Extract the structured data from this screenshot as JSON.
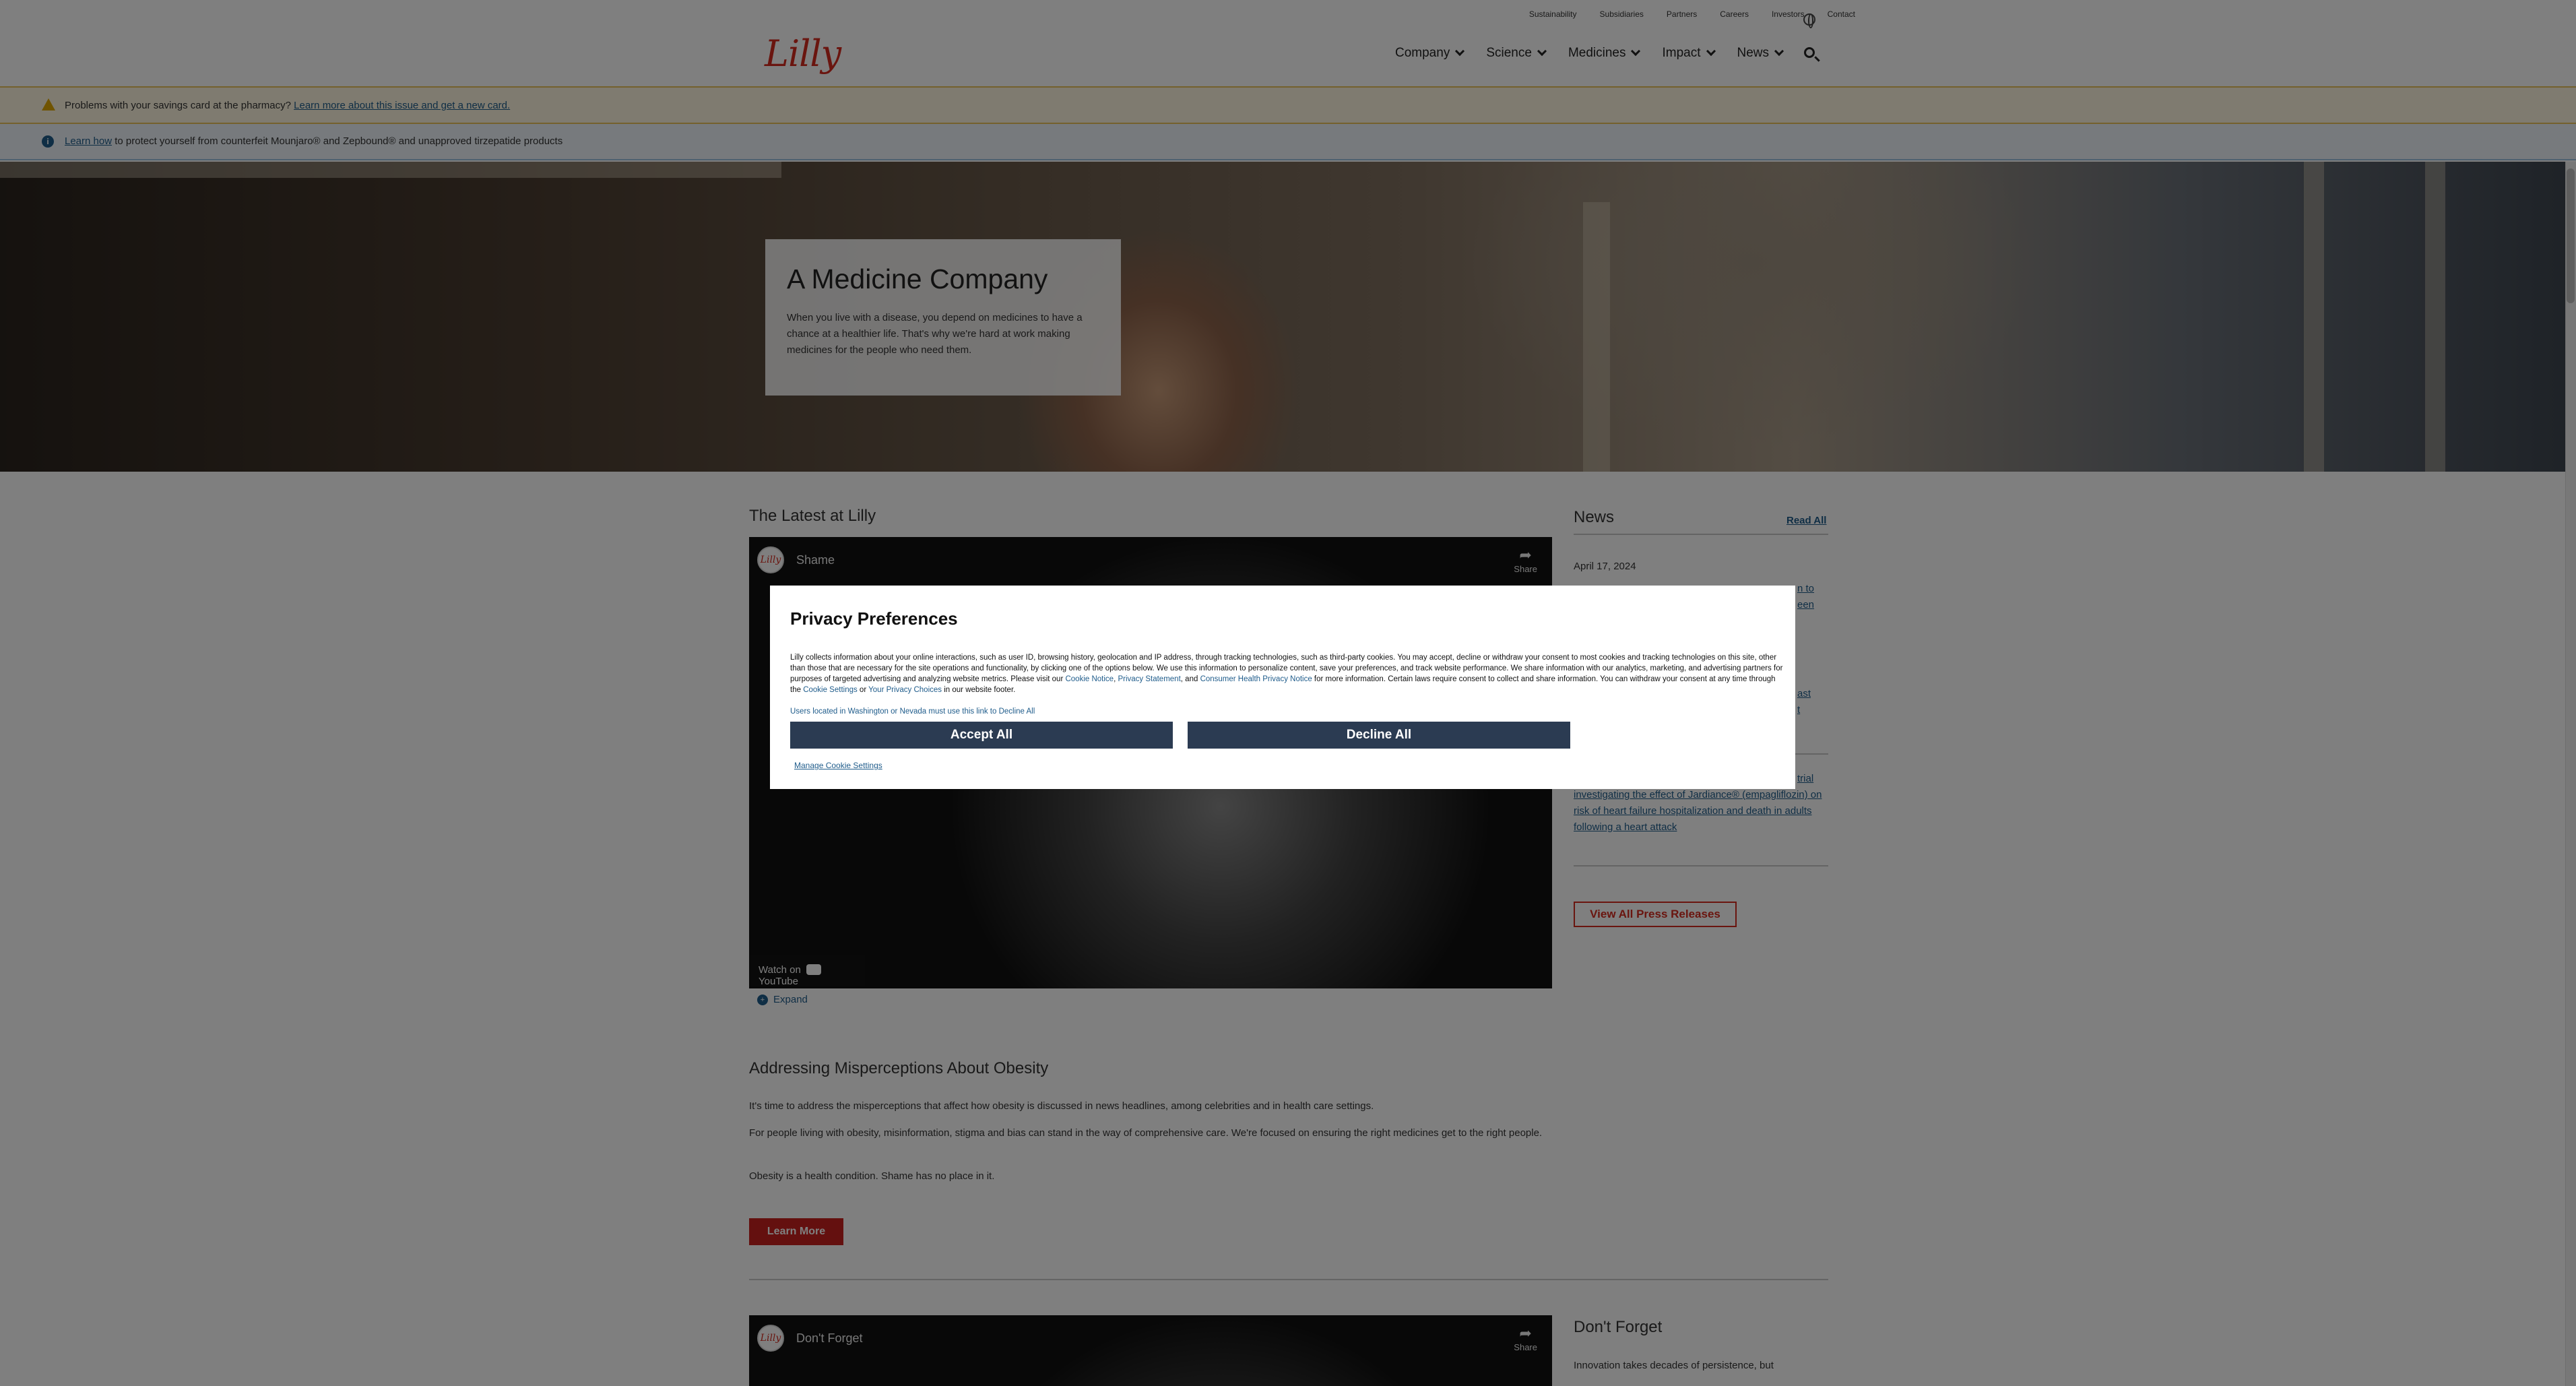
{
  "utility_nav": [
    "Sustainability",
    "Subsidiaries",
    "Partners",
    "Careers",
    "Investors",
    "Contact"
  ],
  "logo": "Lilly",
  "main_nav": [
    "Company",
    "Science",
    "Medicines",
    "Impact",
    "News"
  ],
  "alerts": {
    "savings": {
      "text": "Problems with your savings card at the pharmacy? ",
      "link": "Learn more about this issue and get a new card."
    },
    "counterfeit": {
      "link": "Learn how",
      "text": " to protect yourself from counterfeit Mounjaro® and Zepbound® and unapproved tirzepatide products"
    }
  },
  "hero": {
    "title": "A Medicine Company",
    "body": "When you live with a disease, you depend on medicines to have a chance at a healthier life. That's why we're hard at work making medicines for the people who need them."
  },
  "latest": {
    "heading": "The Latest at Lilly",
    "video_title": "Shame",
    "share": "Share",
    "watch_on": "Watch on",
    "youtube": "YouTube",
    "expand": "Expand"
  },
  "news": {
    "heading": "News",
    "read_all": "Read All",
    "date": "April 17, 2024",
    "item_fragments": [
      "n to",
      "een",
      "ast",
      "t",
      "trial"
    ],
    "item_visible": "investigating the effect of Jardiance® (empagliflozin) on risk of heart failure hospitalization and death in adults following a heart attack",
    "view_all": "View All Press Releases"
  },
  "obesity": {
    "heading": "Addressing Misperceptions About Obesity",
    "p1": "It's time to address the misperceptions that affect how obesity is discussed in news headlines, among celebrities and in health care settings.",
    "p2": "For people living with obesity, misinformation, stigma and bias can stand in the way of comprehensive care. We're focused on ensuring the right medicines get to the right people.",
    "p3": "Obesity is a health condition. Shame has no place in it.",
    "button": "Learn More"
  },
  "dont_forget": {
    "video_title": "Don't Forget",
    "heading": "Don't Forget",
    "text": "Innovation takes decades of persistence, but"
  },
  "privacy": {
    "title": "Privacy Preferences",
    "text_a": "Lilly collects information about your online interactions, such as user ID, browsing history, geolocation and IP address, through tracking technologies, such as third-party cookies. You may accept, decline or withdraw your consent to most cookies and tracking technologies on this site, other than those that are necessary for the site operations and functionality, by clicking one of the options below. We use this information to personalize content, save your preferences, and track website performance. We share information with our analytics, marketing, and advertising partners for purposes of targeted advertising and analyzing website metrics. Please visit our ",
    "link_cookie": "Cookie Notice",
    "link_privacy": "Privacy Statement",
    "link_chp": "Consumer Health Privacy Notice",
    "text_b": " for more information. Certain laws require consent to collect and share information. You can withdraw your consent at any time through the ",
    "link_settings": "Cookie Settings",
    "link_choices": "Your Privacy Choices",
    "text_c": " in our website footer.",
    "wa_nv": "Users located in Washington or Nevada must use this link to Decline All",
    "accept": "Accept All",
    "decline": "Decline All",
    "manage": "Manage Cookie Settings"
  }
}
